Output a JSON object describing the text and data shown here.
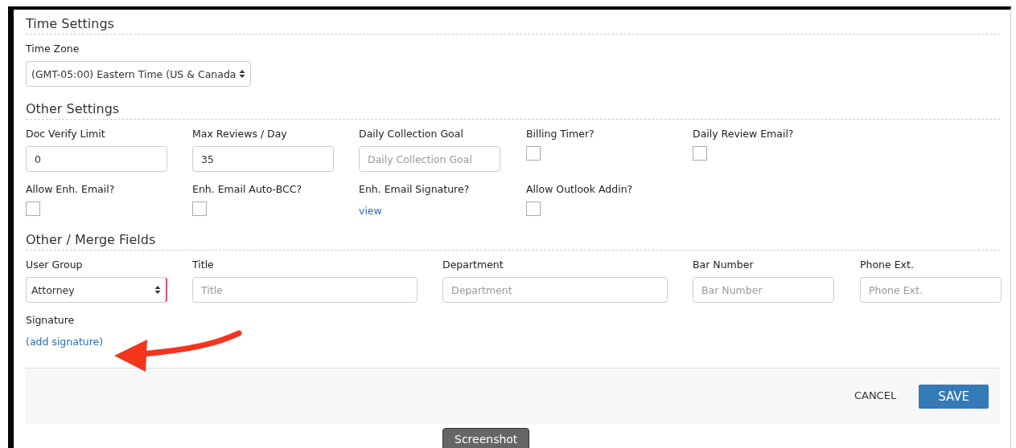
{
  "sections": [
    {
      "title": "Time Settings",
      "rows": [
        [
          {
            "kind": "select",
            "label": "Time Zone",
            "value": "(GMT-05:00) Eastern Time (US & Canada",
            "invalid": false
          }
        ]
      ]
    },
    {
      "title": "Other Settings",
      "rows": [
        [
          {
            "kind": "text",
            "label": "Doc Verify Limit",
            "value": "0"
          },
          {
            "kind": "text",
            "label": "Max Reviews / Day",
            "value": "35"
          },
          {
            "kind": "text",
            "label": "Daily Collection Goal",
            "placeholder": "Daily Collection Goal"
          },
          {
            "kind": "checkbox",
            "label": "Billing Timer?",
            "checked": false
          },
          {
            "kind": "checkbox",
            "label": "Daily Review Email?",
            "checked": false
          }
        ],
        [
          {
            "kind": "checkbox",
            "label": "Allow Enh. Email?",
            "checked": false
          },
          {
            "kind": "checkbox",
            "label": "Enh. Email Auto-BCC?",
            "checked": false
          },
          {
            "kind": "link",
            "label": "Enh. Email Signature?",
            "link": "view"
          },
          {
            "kind": "checkbox",
            "label": "Allow Outlook Addin?",
            "checked": false
          }
        ]
      ]
    },
    {
      "title": "Other / Merge Fields",
      "rows": [
        [
          {
            "kind": "select",
            "label": "User Group",
            "value": "Attorney",
            "invalid": true
          },
          {
            "kind": "text",
            "label": "Title",
            "placeholder": "Title"
          },
          {
            "kind": "text",
            "label": "Department",
            "placeholder": "Department"
          },
          {
            "kind": "text",
            "label": "Bar Number",
            "placeholder": "Bar Number"
          },
          {
            "kind": "text",
            "label": "Phone Ext.",
            "placeholder": "Phone Ext."
          }
        ],
        [
          {
            "kind": "link",
            "label": "Signature",
            "link": "(add signature)"
          }
        ]
      ]
    }
  ],
  "footer": {
    "cancel": "CANCEL",
    "save": "SAVE"
  },
  "overlay_label": "Screenshot"
}
